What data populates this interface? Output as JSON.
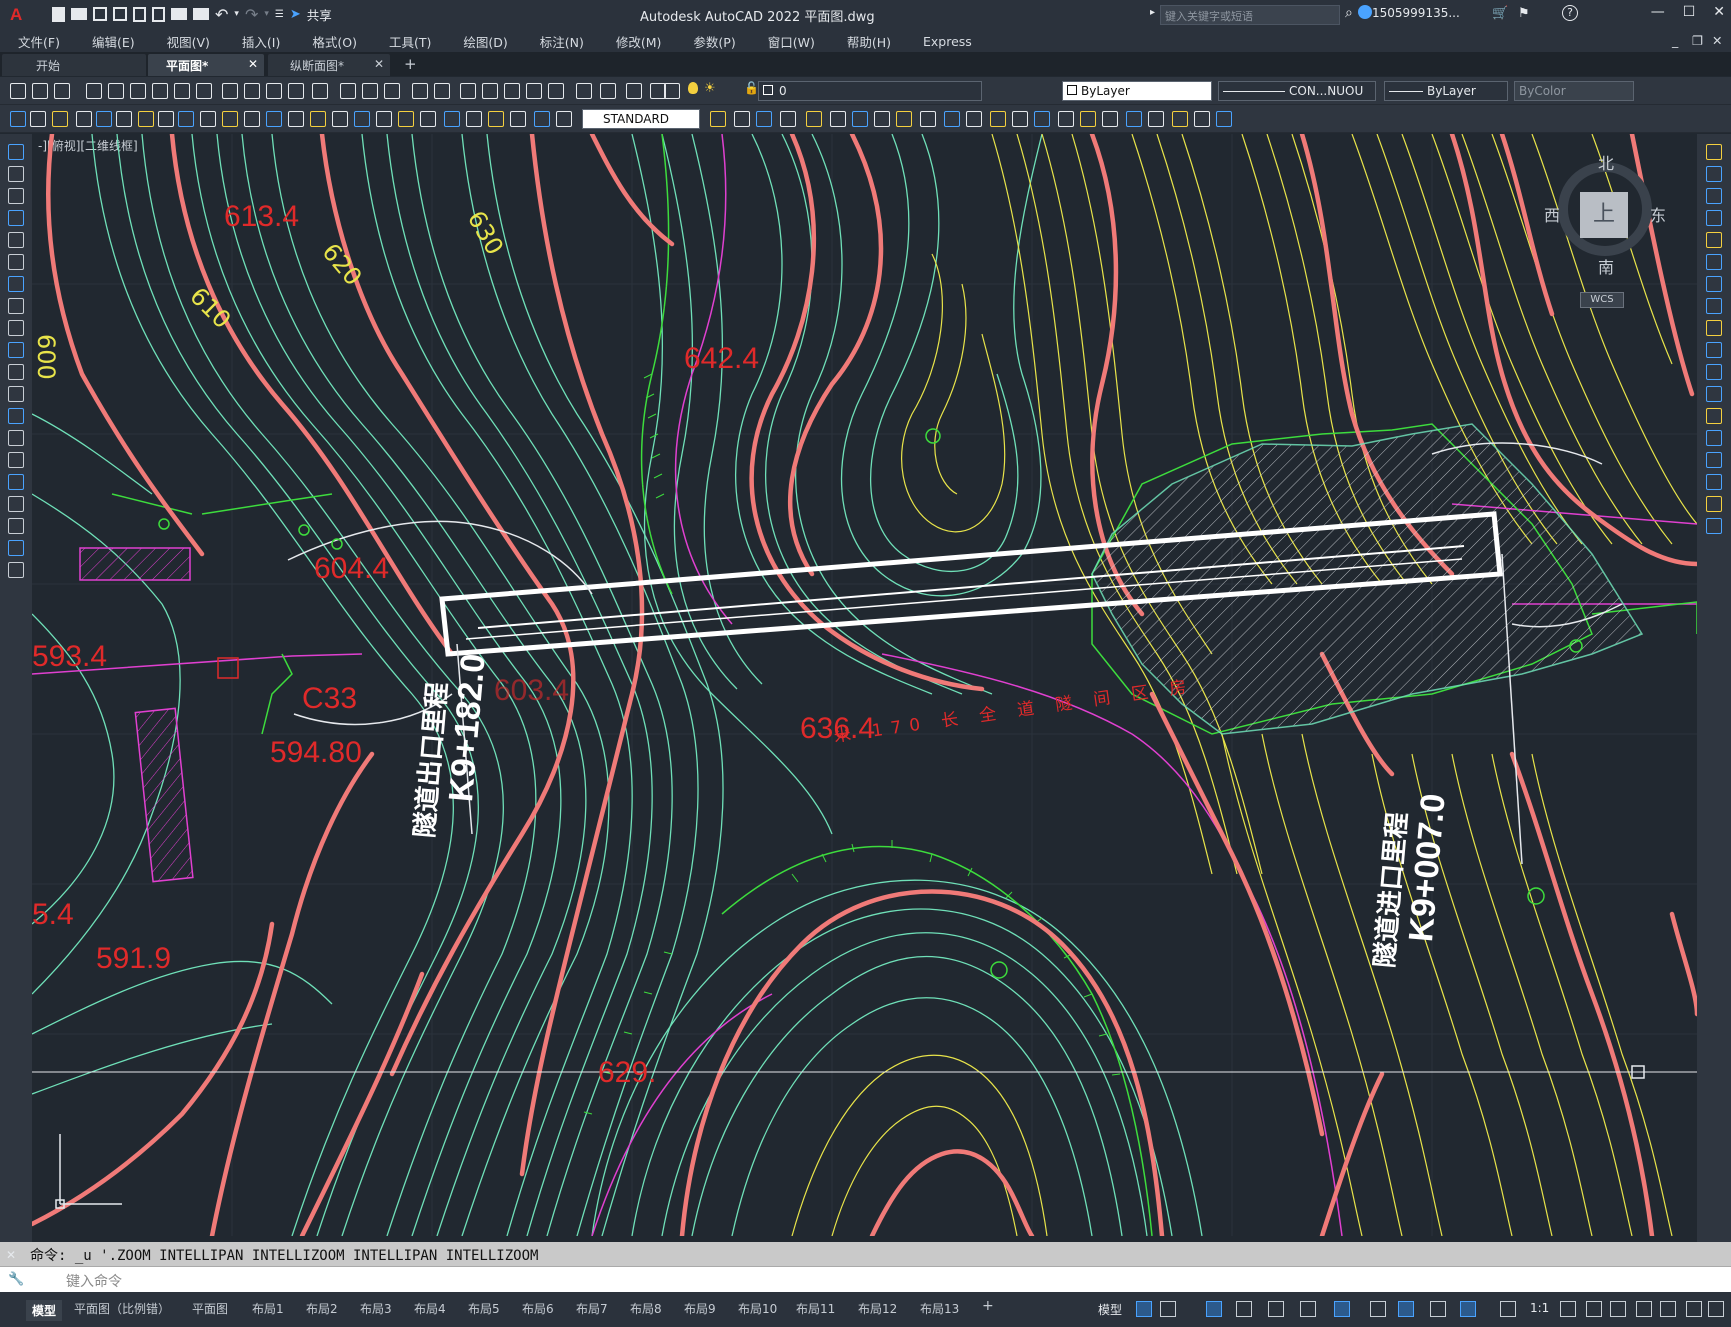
{
  "titlebar": {
    "app_title": "Autodesk AutoCAD 2022    平面图.dwg",
    "share_label": "共享",
    "search_placeholder": "键入关键字或短语",
    "user_label": "1505999135...",
    "help_label": "?"
  },
  "menus": [
    "文件(F)",
    "编辑(E)",
    "视图(V)",
    "插入(I)",
    "格式(O)",
    "工具(T)",
    "绘图(D)",
    "标注(N)",
    "修改(M)",
    "参数(P)",
    "窗口(W)",
    "帮助(H)",
    "Express"
  ],
  "doc_tabs": [
    {
      "label": "开始"
    },
    {
      "label": "平面图*"
    },
    {
      "label": "纵断面图*"
    }
  ],
  "toolbar": {
    "layer_value": "0",
    "color_value": "ByLayer",
    "linetype_value": "CON...NUOU",
    "lineweight_value": "ByLayer",
    "plotstyle_value": "ByColor",
    "textstyle_value": "STANDARD"
  },
  "viewport_label": "-][俯视][二维线框]",
  "viewcube": {
    "north": "北",
    "south": "南",
    "east": "东",
    "west": "西",
    "top": "上",
    "wcs": "WCS"
  },
  "drawing_labels": {
    "exit_station": "K9+182.0",
    "exit_caption": "隧道出口里程",
    "entrance_station": "K9+007.0",
    "entrance_caption": "隧道进口里程",
    "elev_6134": "613.4",
    "elev_6424": "642.4",
    "elev_6044": "604.4",
    "elev_5934": "593.4",
    "code_c33": "C33",
    "elev_59480": "594.80",
    "elev_6364": "636.4",
    "elev_5919": "591.9",
    "elev_54": "5.4",
    "elev_629": "629.",
    "elev_6034": "603.4",
    "contour_600": "600",
    "contour_610": "610",
    "contour_620": "620",
    "contour_630": "630",
    "tunnel_note": "米 170 长 全 道 隧 间 区 房"
  },
  "command": {
    "history": "命令: _u '.ZOOM INTELLIPAN INTELLIZOOM INTELLIPAN INTELLIZOOM",
    "placeholder": "键入命令"
  },
  "layout_tabs": [
    "模型",
    "平面图（比例错）",
    "平面图",
    "布局1",
    "布局2",
    "布局3",
    "布局4",
    "布局5",
    "布局6",
    "布局7",
    "布局8",
    "布局9",
    "布局10",
    "布局11",
    "布局12",
    "布局13"
  ],
  "status": {
    "model_label": "模型",
    "scale_label": "1:1"
  },
  "colors": {
    "canvas_bg": "#212830",
    "contour_index": "#f07a78",
    "contour_minor": "#6fe0b8",
    "contour_yellow": "#e8e44a",
    "magenta": "#e040d0",
    "green": "#3ddc3d",
    "red_text": "#e02a2a"
  }
}
